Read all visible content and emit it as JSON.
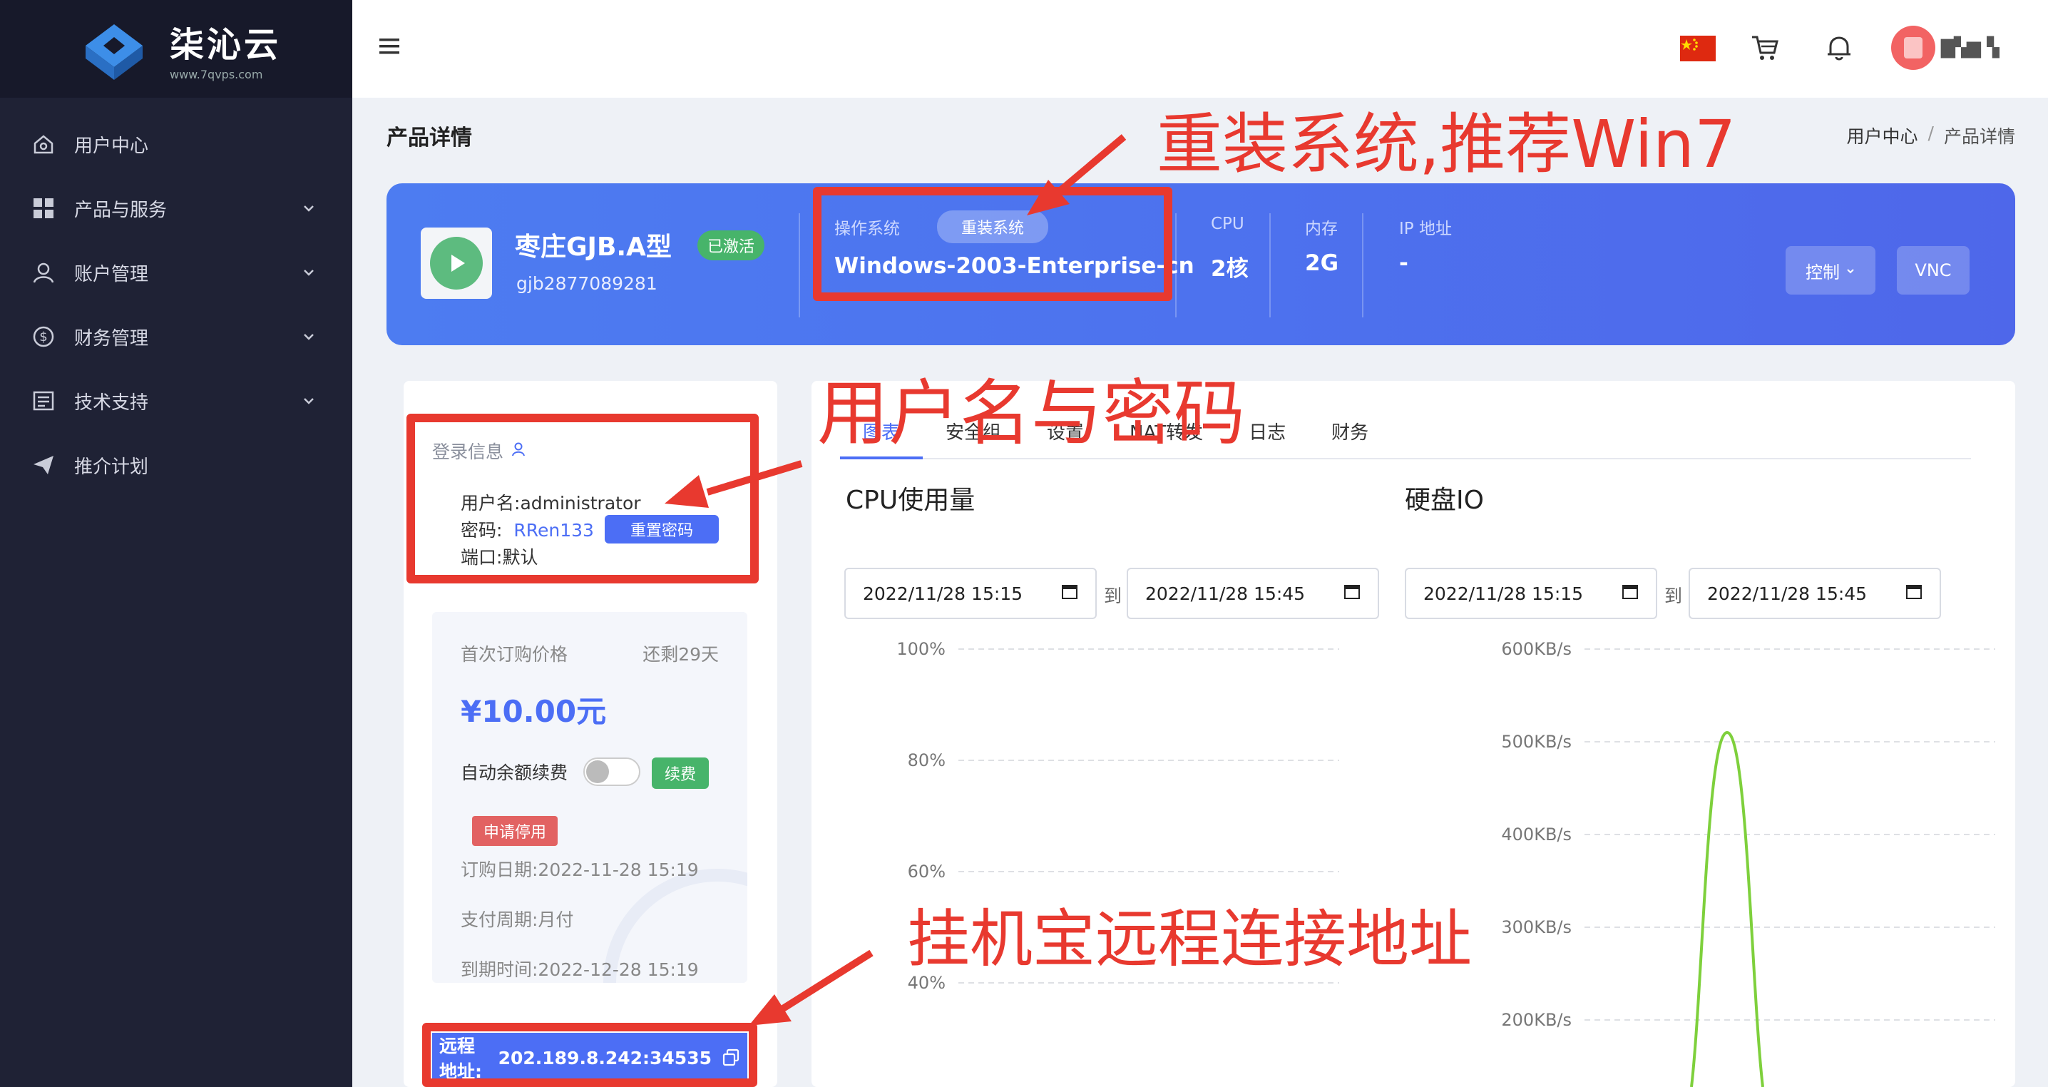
{
  "brand": {
    "name": "柒沁云",
    "site": "www.7qvps.com"
  },
  "sidebar": {
    "items": [
      {
        "label": "用户中心",
        "icon": "home-icon",
        "has_children": false
      },
      {
        "label": "产品与服务",
        "icon": "grid-icon",
        "has_children": true
      },
      {
        "label": "账户管理",
        "icon": "user-icon",
        "has_children": true
      },
      {
        "label": "财务管理",
        "icon": "dollar-icon",
        "has_children": true
      },
      {
        "label": "技术支持",
        "icon": "doc-icon",
        "has_children": true
      },
      {
        "label": "推介计划",
        "icon": "send-icon",
        "has_children": false
      }
    ]
  },
  "topbar": {
    "username": "▇▚▆▝▖"
  },
  "page": {
    "title": "产品详情",
    "breadcrumb": [
      "用户中心",
      "/",
      "产品详情"
    ]
  },
  "product": {
    "name": "枣庄GJB.A型",
    "status": "已激活",
    "id": "gjb2877089281",
    "os_label": "操作系统",
    "reinstall_label": "重装系统",
    "os_value": "Windows-2003-Enterprise-cn",
    "cpu_label": "CPU",
    "cpu_value": "2核",
    "mem_label": "内存",
    "mem_value": "2G",
    "ip_label": "IP 地址",
    "ip_value": "-",
    "control_label": "控制",
    "vnc_label": "VNC"
  },
  "login": {
    "title": "登录信息",
    "username_label": "用户名:",
    "username": "administrator",
    "password_label": "密码:",
    "password": "RRen133",
    "reset_label": "重置密码",
    "port_label": "端口:",
    "port": "默认"
  },
  "billing": {
    "first_price_label": "首次订购价格",
    "remaining": "还剩29天",
    "price": "¥10.00元",
    "auto_renew_label": "自动余额续费",
    "auto_renew_on": false,
    "renew_label": "续费",
    "stop_label": "申请停用",
    "order_date": "订购日期:2022-11-28 15:19",
    "pay_cycle": "支付周期:月付",
    "expire": "到期时间:2022-12-28 15:19"
  },
  "remote": {
    "label": "远程地址:",
    "value": "202.189.8.242:34535"
  },
  "tabs": [
    "图表",
    "安全组",
    "设置",
    "NAT转发",
    "日志",
    "财务"
  ],
  "active_tab": 0,
  "cpu_section": {
    "title": "CPU使用量",
    "from": "2022/11/28  15:15",
    "to_word": "到",
    "to": "2022/11/28  15:45"
  },
  "disk_section": {
    "title": "硬盘IO",
    "from": "2022/11/28  15:15",
    "to_word": "到",
    "to": "2022/11/28  15:45"
  },
  "chart_data": [
    {
      "type": "line",
      "title": "CPU使用量",
      "y_ticks": [
        "100%",
        "80%",
        "60%",
        "40%"
      ],
      "ylim_visible": [
        40,
        100
      ],
      "series": []
    },
    {
      "type": "line",
      "title": "硬盘IO",
      "y_ticks": [
        "600KB/s",
        "500KB/s",
        "400KB/s",
        "300KB/s",
        "200KB/s"
      ],
      "series": [
        {
          "color": "#7ed03c",
          "shape": "single spike",
          "peak": 510
        }
      ]
    }
  ],
  "annotations": {
    "reinstall": "重装系统,推荐Win7",
    "credentials": "用户名与密码",
    "remote": "挂机宝远程连接地址"
  },
  "colors": {
    "accent": "#4c6ef5",
    "annotation": "#e8392f",
    "sidebar": "#1f2235",
    "success": "#47b46a"
  }
}
